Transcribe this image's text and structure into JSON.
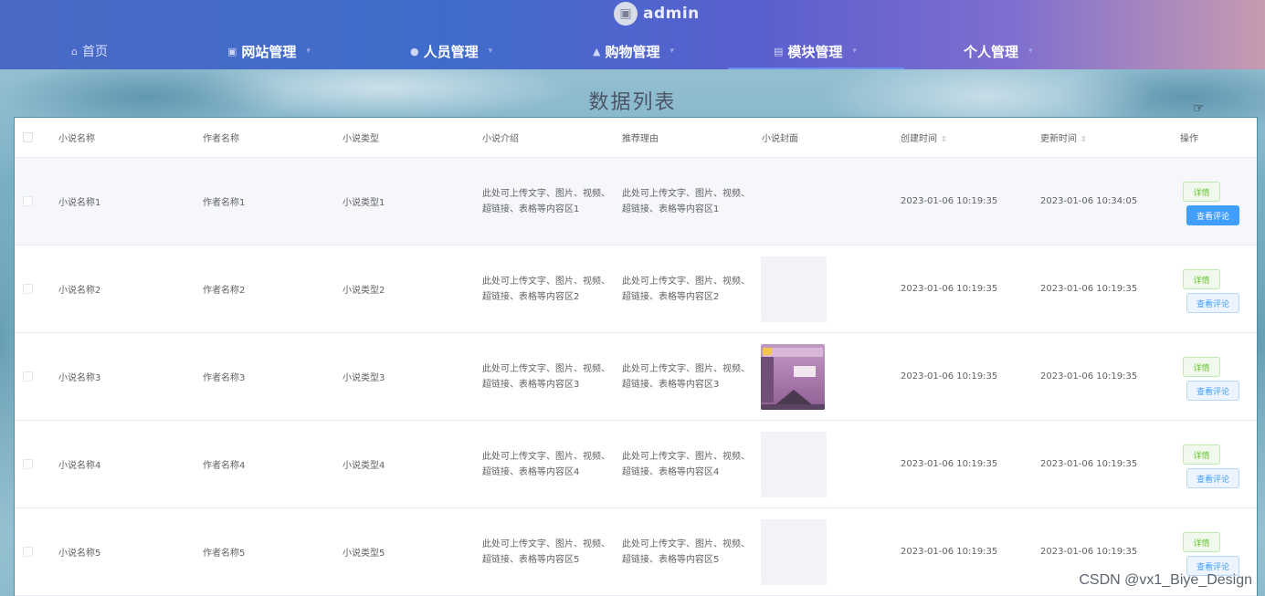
{
  "header": {
    "brand_name": "admin",
    "nav": [
      {
        "label": "首页",
        "icon": "home-icon"
      },
      {
        "label": "网站管理",
        "icon": "monitor-icon"
      },
      {
        "label": "人员管理",
        "icon": "user-icon"
      },
      {
        "label": "购物管理",
        "icon": "bag-icon"
      },
      {
        "label": "模块管理",
        "icon": "grid-icon",
        "active": true
      },
      {
        "label": "个人管理",
        "icon": ""
      }
    ]
  },
  "page": {
    "title": "数据列表"
  },
  "table": {
    "columns": [
      "小说名称",
      "作者名称",
      "小说类型",
      "小说介绍",
      "推荐理由",
      "小说封面",
      "创建时间",
      "更新时间",
      "操作"
    ],
    "rows": [
      {
        "name": "小说名称1",
        "author": "作者名称1",
        "type": "小说类型1",
        "intro": "此处可上传文字、图片、视频、超链接、表格等内容区1",
        "reason": "此处可上传文字、图片、视频、超链接、表格等内容区1",
        "created": "2023-01-06 10:19:35",
        "updated": "2023-01-06 10:34:05"
      },
      {
        "name": "小说名称2",
        "author": "作者名称2",
        "type": "小说类型2",
        "intro": "此处可上传文字、图片、视频、超链接、表格等内容区2",
        "reason": "此处可上传文字、图片、视频、超链接、表格等内容区2",
        "created": "2023-01-06 10:19:35",
        "updated": "2023-01-06 10:19:35"
      },
      {
        "name": "小说名称3",
        "author": "作者名称3",
        "type": "小说类型3",
        "intro": "此处可上传文字、图片、视频、超链接、表格等内容区3",
        "reason": "此处可上传文字、图片、视频、超链接、表格等内容区3",
        "created": "2023-01-06 10:19:35",
        "updated": "2023-01-06 10:19:35"
      },
      {
        "name": "小说名称4",
        "author": "作者名称4",
        "type": "小说类型4",
        "intro": "此处可上传文字、图片、视频、超链接、表格等内容区4",
        "reason": "此处可上传文字、图片、视频、超链接、表格等内容区4",
        "created": "2023-01-06 10:19:35",
        "updated": "2023-01-06 10:19:35"
      },
      {
        "name": "小说名称5",
        "author": "作者名称5",
        "type": "小说类型5",
        "intro": "此处可上传文字、图片、视频、超链接、表格等内容区5",
        "reason": "此处可上传文字、图片、视频、超链接、表格等内容区5",
        "created": "2023-01-06 10:19:35",
        "updated": "2023-01-06 10:19:35"
      }
    ],
    "actions": {
      "detail_label": "详情",
      "comment_label": "查看评论"
    }
  },
  "watermark": "CSDN @vx1_Biye_Design",
  "colors": {
    "header_start": "#4a69c6",
    "header_end": "#c79bb0",
    "primary": "#409eff",
    "success": "#67c23a"
  }
}
